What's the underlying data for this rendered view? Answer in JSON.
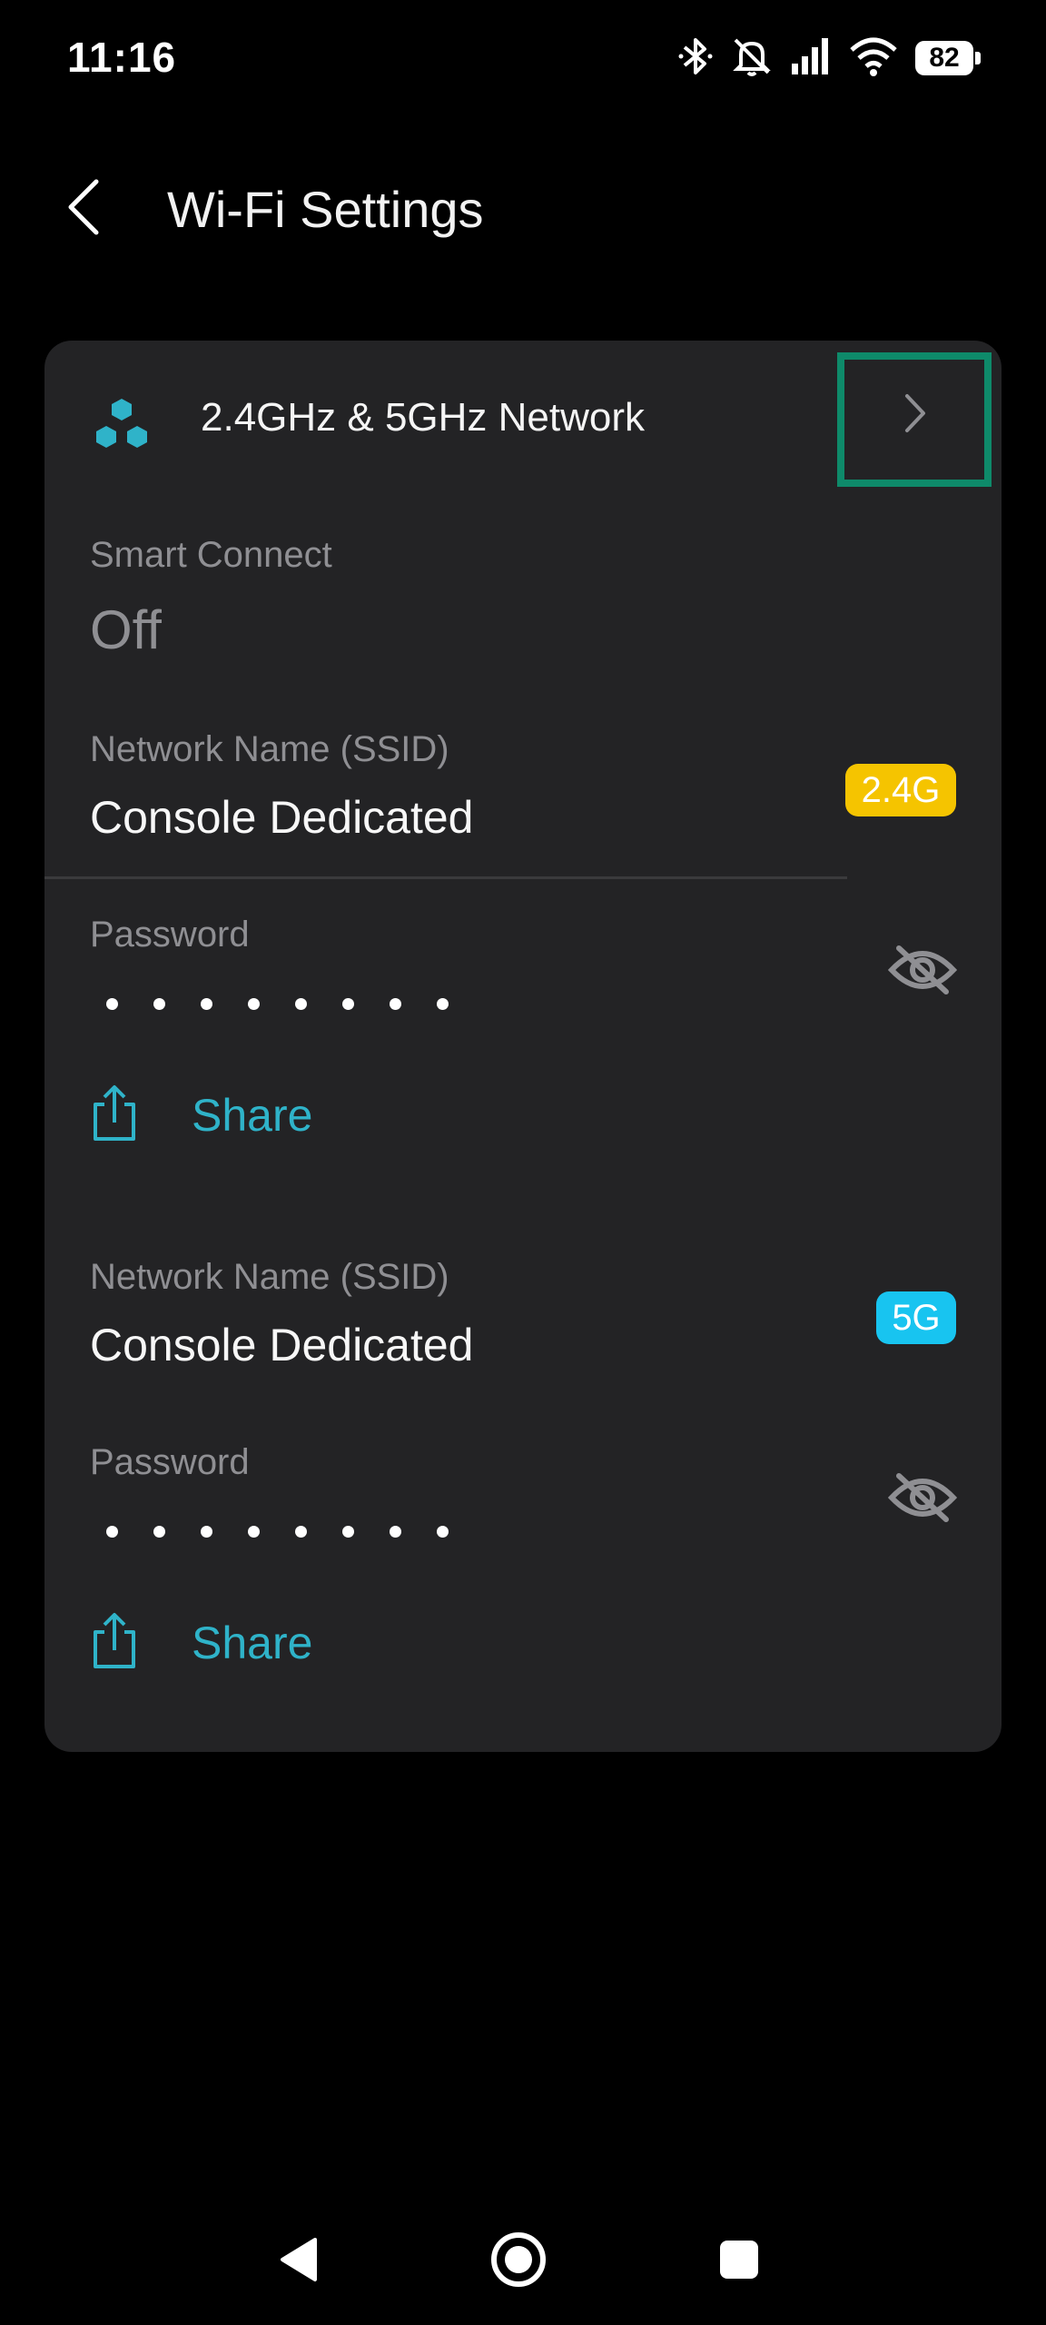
{
  "status_bar": {
    "time": "11:16",
    "battery": "82",
    "icons": [
      "bluetooth-icon",
      "mute-icon",
      "signal-icon",
      "wifi-icon",
      "battery-icon"
    ]
  },
  "app_bar": {
    "title": "Wi-Fi Settings",
    "back_icon": "chevron-left-icon"
  },
  "card": {
    "header_title": "2.4GHz & 5GHz Network",
    "header_icon": "network-nodes-icon",
    "smart_connect": {
      "label": "Smart Connect",
      "value": "Off"
    },
    "networks": [
      {
        "ssid_label": "Network Name (SSID)",
        "ssid": "Console Dedicated",
        "band": "2.4G",
        "band_color": "#f5c400",
        "password_label": "Password",
        "share_label": "Share"
      },
      {
        "ssid_label": "Network Name (SSID)",
        "ssid": "Console Dedicated",
        "band": "5G",
        "band_color": "#18c4f0",
        "password_label": "Password",
        "share_label": "Share"
      }
    ]
  },
  "colors": {
    "accent": "#2fb3c9",
    "card_bg": "#232325",
    "highlight": "#0e8a6a"
  },
  "nav_bar": {
    "icons": [
      "back-triangle-icon",
      "home-circle-icon",
      "recents-square-icon"
    ]
  }
}
